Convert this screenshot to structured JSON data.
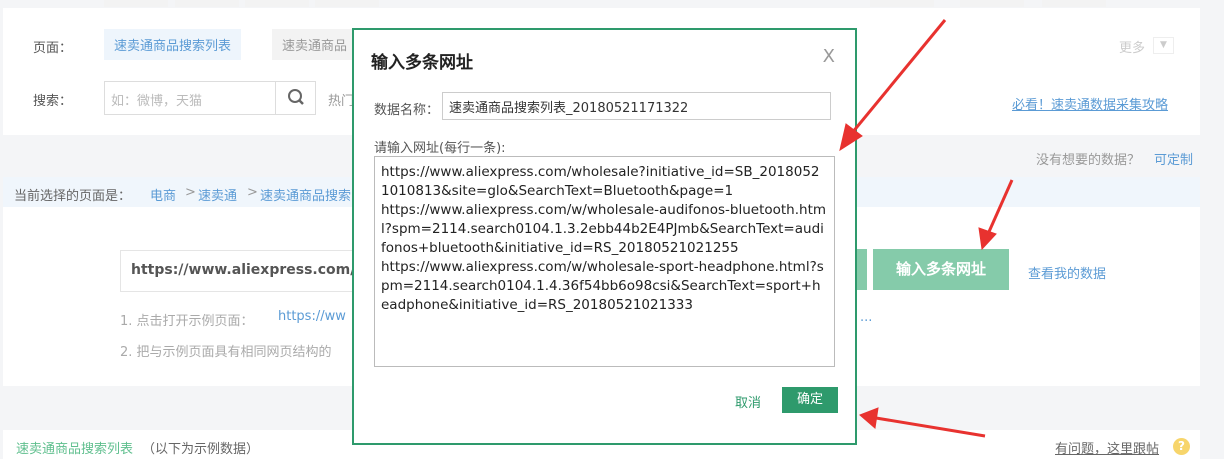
{
  "filters": {
    "page_label": "页面：",
    "page_options": [
      "速卖通商品搜索列表",
      "速卖通商品"
    ],
    "more_label": "更多",
    "search_label": "搜索：",
    "search_placeholder": "如：微博，天猫",
    "hot_label": "热门",
    "guide_link": "必看！速卖通数据采集攻略"
  },
  "custom": {
    "question": "没有想要的数据？",
    "link": "可定制"
  },
  "breadcrumb": {
    "label": "当前选择的页面是：",
    "items": [
      "电商",
      "速卖通",
      "速卖通商品搜索"
    ],
    "sep": ">"
  },
  "main": {
    "url_value": "https://www.aliexpress.com/wh",
    "multi_url_button": "输入多条网址",
    "my_data_link": "查看我的数据",
    "step1": "1. 点击打开示例页面：",
    "step1_link": "https://ww",
    "step1_more": "...",
    "step2": "2. 把与示例页面具有相同网页结构的"
  },
  "footer": {
    "title": "速卖通商品搜索列表",
    "note": "（以下为示例数据）",
    "help": "有问题，这里跟帖"
  },
  "dialog": {
    "title": "输入多条网址",
    "close": "X",
    "name_label": "数据名称：",
    "name_value": "速卖通商品搜索列表_20180521171322",
    "urls_label": "请输入网址(每行一条):",
    "urls": [
      "https://www.aliexpress.com/wholesale?initiative_id=SB_20180521010813&site=glo&SearchText=Bluetooth&page=1",
      "https://www.aliexpress.com/w/wholesale-audifonos-bluetooth.html?spm=2114.search0104.1.3.2ebb44b2E4PJmb&SearchText=audifonos+bluetooth&initiative_id=RS_20180521021255",
      "https://www.aliexpress.com/w/wholesale-sport-headphone.html?spm=2114.search0104.1.4.36f54bb6o98csi&SearchText=sport+headphone&initiative_id=RS_20180521021333"
    ],
    "cancel": "取消",
    "confirm": "确定"
  },
  "colors": {
    "accent": "#2e9a6c",
    "link": "#5b9bd5",
    "arrow": "#e8322f"
  }
}
